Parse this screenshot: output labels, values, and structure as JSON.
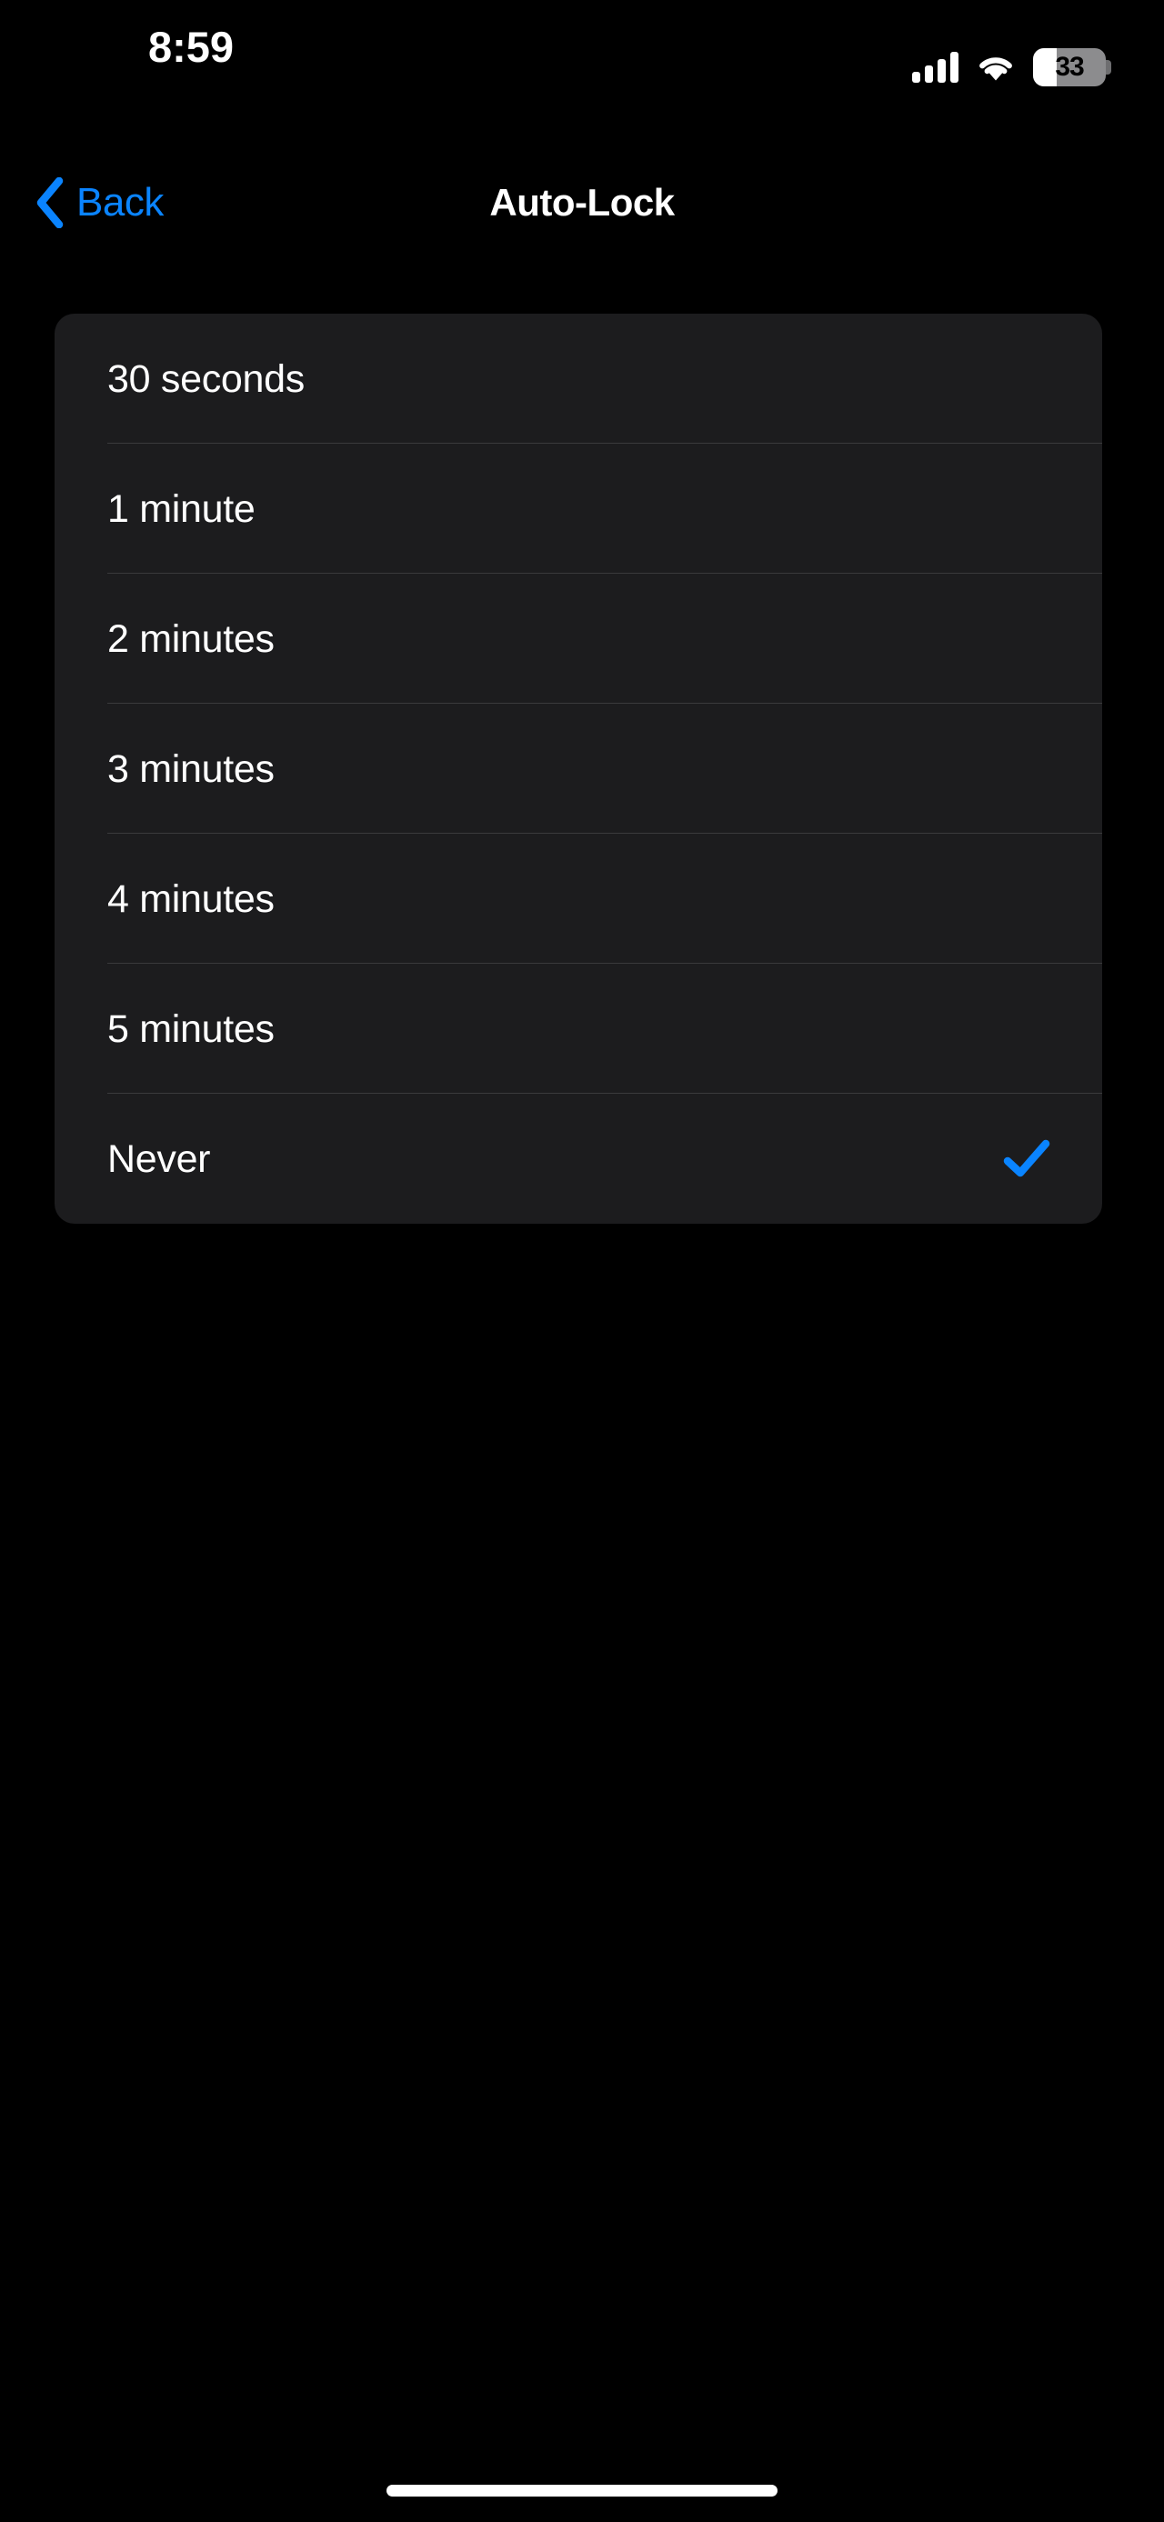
{
  "status_bar": {
    "time": "8:59",
    "signal_icon": "cellular-signal-icon",
    "signal_bars": 4,
    "wifi_icon": "wifi-icon",
    "battery_icon": "battery-icon",
    "battery_percent_label": "33",
    "battery_percent": 33
  },
  "nav_bar": {
    "back_icon": "chevron-left-icon",
    "back_label": "Back",
    "title": "Auto-Lock"
  },
  "colors": {
    "background": "#000000",
    "card_background": "#1C1C1E",
    "accent_blue": "#0A84FF",
    "separator": "#3A3A3C",
    "primary_text": "#FFFFFF"
  },
  "list": {
    "selected_value": "Never",
    "checkmark_icon": "checkmark-icon",
    "rows": [
      {
        "label": "30 seconds",
        "selected": false
      },
      {
        "label": "1 minute",
        "selected": false
      },
      {
        "label": "2 minutes",
        "selected": false
      },
      {
        "label": "3 minutes",
        "selected": false
      },
      {
        "label": "4 minutes",
        "selected": false
      },
      {
        "label": "5 minutes",
        "selected": false
      },
      {
        "label": "Never",
        "selected": true
      }
    ]
  },
  "home_indicator": {
    "name": "home-indicator"
  }
}
